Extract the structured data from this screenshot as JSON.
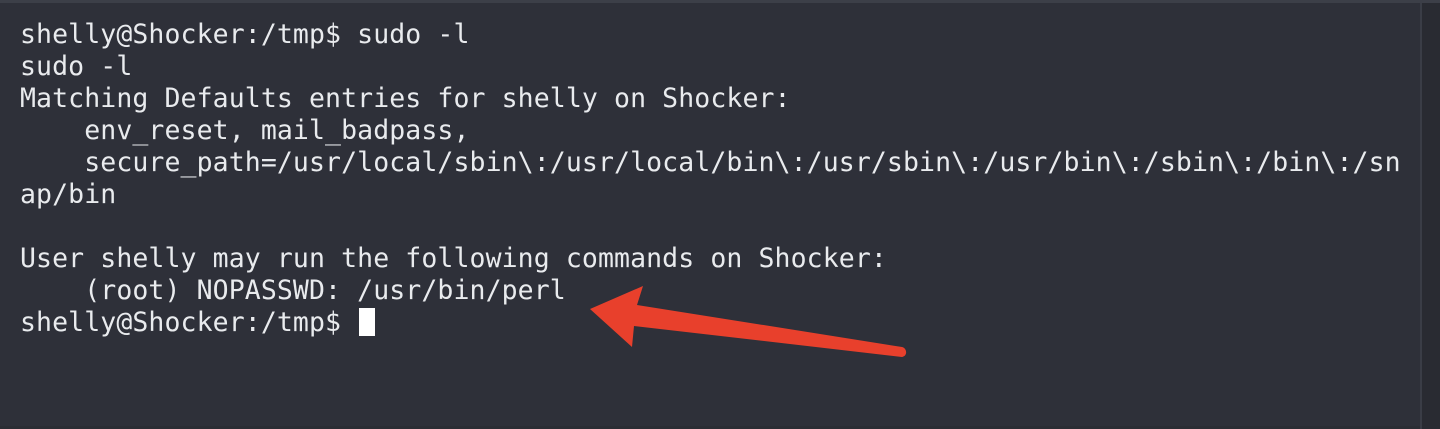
{
  "terminal": {
    "lines": [
      "shelly@Shocker:/tmp$ sudo -l",
      "sudo -l",
      "Matching Defaults entries for shelly on Shocker:",
      "    env_reset, mail_badpass,",
      "    secure_path=/usr/local/sbin\\:/usr/local/bin\\:/usr/sbin\\:/usr/bin\\:/sbin\\:/bin\\:/sn",
      "ap/bin",
      "",
      "User shelly may run the following commands on Shocker:",
      "    (root) NOPASSWD: /usr/bin/perl"
    ],
    "prompt": "shelly@Shocker:/tmp$ "
  },
  "annotation": {
    "arrow_color": "#e8402c"
  }
}
